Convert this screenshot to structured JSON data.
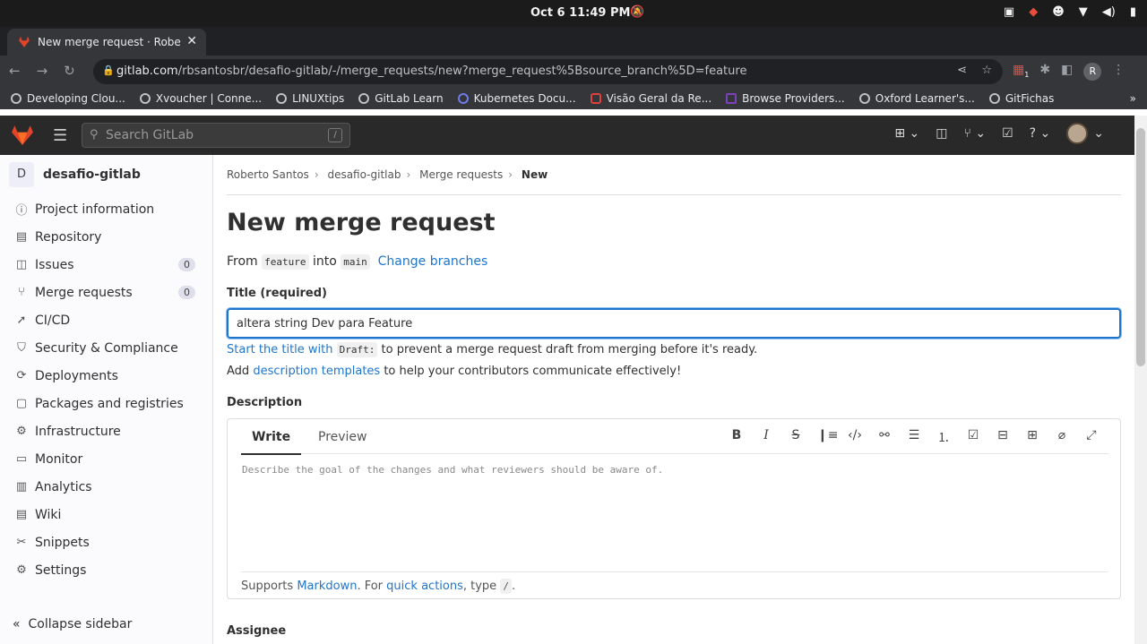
{
  "system": {
    "clock": "Oct 6  11:49 PM"
  },
  "browser": {
    "tab_title": "New merge request · Roberto",
    "url_host": "gitlab.com",
    "url_path": "/rbsantosbr/desafio-gitlab/-/merge_requests/new?merge_request%5Bsource_branch%5D=feature",
    "profile_initial": "R",
    "extension_badge": "1",
    "bookmarks": [
      "Developing Clou...",
      "Xvoucher | Conne...",
      "LINUXtips",
      "GitLab Learn",
      "Kubernetes Docu...",
      "Visão Geral da Re...",
      "Browse Providers...",
      "Oxford Learner's...",
      "GitFichas"
    ]
  },
  "gitlab": {
    "search_placeholder": "Search GitLab",
    "search_shortcut": "/",
    "project_initial": "D",
    "project_name": "desafio-gitlab",
    "menu": [
      {
        "label": "Project information",
        "icon": "info-icon"
      },
      {
        "label": "Repository",
        "icon": "book-icon"
      },
      {
        "label": "Issues",
        "icon": "issues-icon",
        "count": "0"
      },
      {
        "label": "Merge requests",
        "icon": "merge-request-icon",
        "count": "0"
      },
      {
        "label": "CI/CD",
        "icon": "rocket-icon"
      },
      {
        "label": "Security & Compliance",
        "icon": "shield-icon"
      },
      {
        "label": "Deployments",
        "icon": "deployments-icon"
      },
      {
        "label": "Packages and registries",
        "icon": "package-icon"
      },
      {
        "label": "Infrastructure",
        "icon": "cloud-gear-icon"
      },
      {
        "label": "Monitor",
        "icon": "monitor-icon"
      },
      {
        "label": "Analytics",
        "icon": "chart-icon"
      },
      {
        "label": "Wiki",
        "icon": "book-icon"
      },
      {
        "label": "Snippets",
        "icon": "scissors-icon"
      },
      {
        "label": "Settings",
        "icon": "gear-icon"
      }
    ],
    "collapse_label": "Collapse sidebar",
    "breadcrumbs": [
      "Roberto Santos",
      "desafio-gitlab",
      "Merge requests",
      "New"
    ],
    "page_title": "New merge request",
    "from_label": "From",
    "source_branch": "feature",
    "into_label": "into",
    "target_branch": "main",
    "change_branches": "Change branches",
    "title_label": "Title (required)",
    "title_value": "altera string Dev para Feature",
    "draft_hint_link": "Start the title with",
    "draft_code": "Draft:",
    "draft_hint_rest": "to prevent a merge request draft from merging before it's ready.",
    "templates_prefix": "Add",
    "templates_link": "description templates",
    "templates_rest": "to help your contributors communicate effectively!",
    "description_label": "Description",
    "write_tab": "Write",
    "preview_tab": "Preview",
    "description_placeholder": "Describe the goal of the changes and what reviewers should be aware of.",
    "supports": "Supports",
    "markdown_link": "Markdown",
    "for_text": ". For",
    "quick_actions_link": "quick actions",
    "type_text": ", type",
    "slash": "/",
    "assignee_label": "Assignee"
  }
}
